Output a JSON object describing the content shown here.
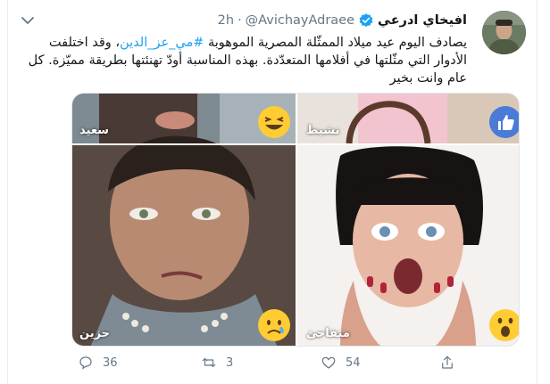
{
  "tweet": {
    "author_name": "افيخاي ادرعي",
    "handle": "@AvichayAdraee",
    "dot": "·",
    "time": "2h",
    "text_before": "يصادف اليوم عيد ميلاد الممثّلة المصرية الموهوبة ",
    "hashtag": "#مي_عز_الدين",
    "text_after": "، وقد اختلفت الأدوار التي مثّلتها في أفلامها المتعدّدة. بهذه المناسبة أودّ تهنئتها بطريقة مميّزة. كل عام وانت بخير"
  },
  "media": {
    "labels": {
      "top_left": "سعيد",
      "top_right": "نشيط",
      "bottom_left": "حزين",
      "bottom_right": "متفاجئ"
    },
    "reactions": {
      "top_left": "laughing-emoji",
      "top_right": "like-thumbs-up",
      "bottom_left": "sad-emoji",
      "bottom_right": "surprised-emoji"
    }
  },
  "actions": {
    "replies": "36",
    "retweets": "3",
    "likes": "54"
  },
  "colors": {
    "accent": "#1da1f2",
    "secondary_text": "#657786",
    "emoji_yellow": "#ffcc33"
  }
}
